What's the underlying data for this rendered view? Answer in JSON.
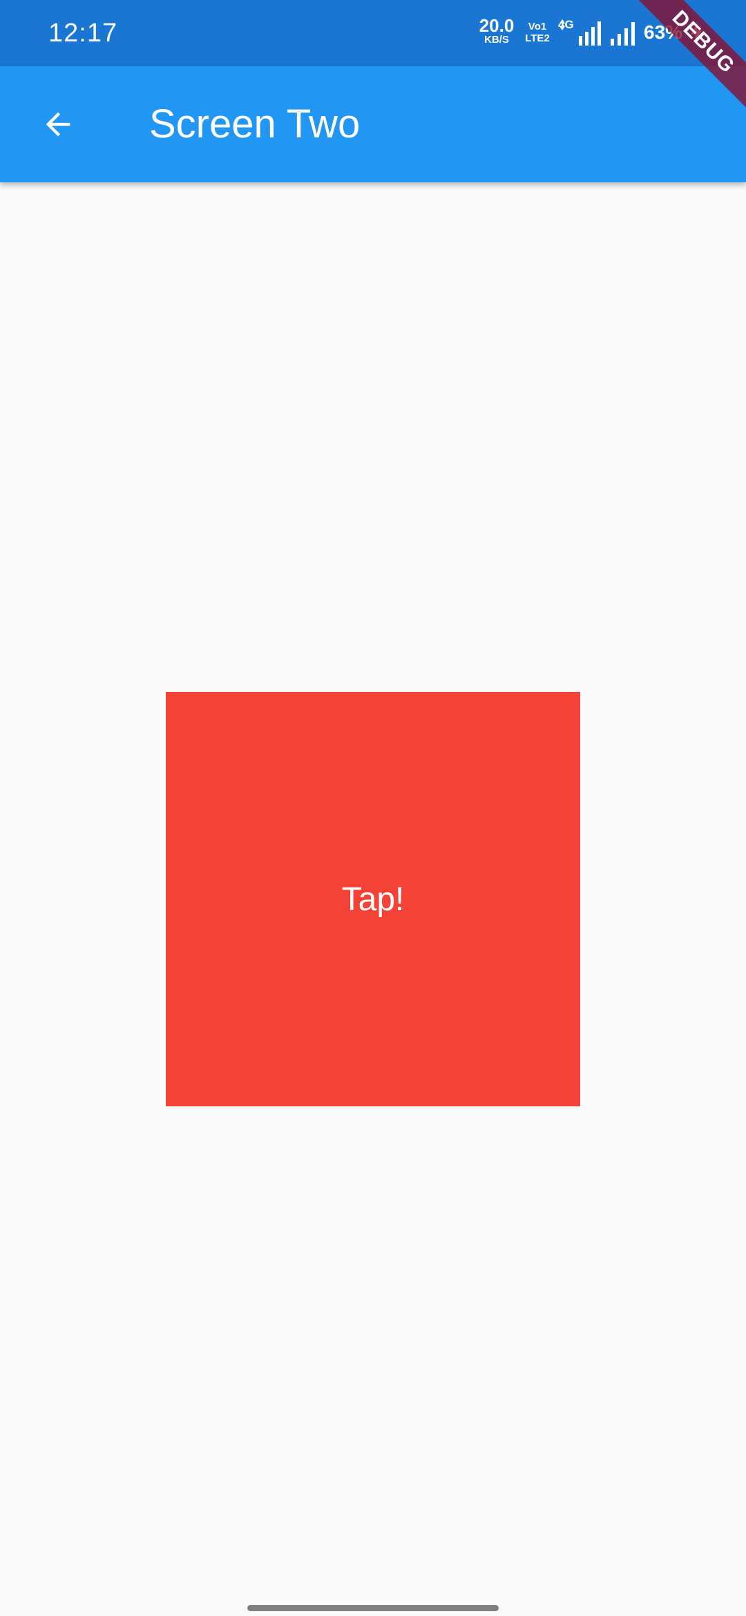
{
  "status_bar": {
    "time": "12:17",
    "net_speed_value": "20.0",
    "net_speed_unit": "KB/S",
    "volte_top": "Vo",
    "volte_bottom": "LTE",
    "volte_badge_top": "1",
    "volte_badge_bottom": "2",
    "network_type": "4G",
    "battery": "63%",
    "background_color": "#1976d2"
  },
  "debug_banner": {
    "label": "DEBUG"
  },
  "app_bar": {
    "title": "Screen Two",
    "back_icon": "arrow-back-icon",
    "background_color": "#2196f3"
  },
  "main": {
    "box_label": "Tap!",
    "box_color": "#f44336",
    "background_color": "#fafafa"
  }
}
